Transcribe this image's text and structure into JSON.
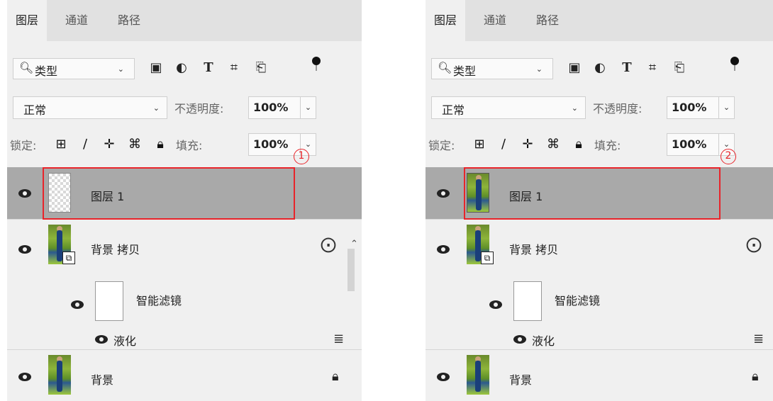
{
  "panels": [
    {
      "tabs": [
        "图层",
        "通道",
        "路径"
      ],
      "filter": {
        "label": "类型"
      },
      "filter_icons": [
        "image-filter-icon",
        "adjustment-filter-icon",
        "type-filter-icon",
        "shape-filter-icon",
        "smart-object-filter-icon"
      ],
      "blend_mode": "正常",
      "opacity_label": "不透明度:",
      "opacity_value": "100%",
      "lock_label": "锁定:",
      "fill_label": "填充:",
      "fill_value": "100%",
      "step": "1",
      "layers": {
        "layer1": "图层 1",
        "copy": "背景 拷贝",
        "smart_filters": "智能滤镜",
        "liquify": "液化",
        "background": "背景"
      },
      "layer1_thumbnail": "transparent"
    },
    {
      "tabs": [
        "图层",
        "通道",
        "路径"
      ],
      "filter": {
        "label": "类型"
      },
      "filter_icons": [
        "image-filter-icon",
        "adjustment-filter-icon",
        "type-filter-icon",
        "shape-filter-icon",
        "smart-object-filter-icon"
      ],
      "blend_mode": "正常",
      "opacity_label": "不透明度:",
      "opacity_value": "100%",
      "lock_label": "锁定:",
      "fill_label": "填充:",
      "fill_value": "100%",
      "step": "2",
      "layers": {
        "layer1": "图层 1",
        "copy": "背景 拷贝",
        "smart_filters": "智能滤镜",
        "liquify": "液化",
        "background": "背景"
      },
      "layer1_thumbnail": "photo"
    }
  ],
  "colors": {
    "highlight": "#e8242a",
    "selected_row": "#a9a9a9",
    "panel_bg": "#f0f0f0"
  }
}
